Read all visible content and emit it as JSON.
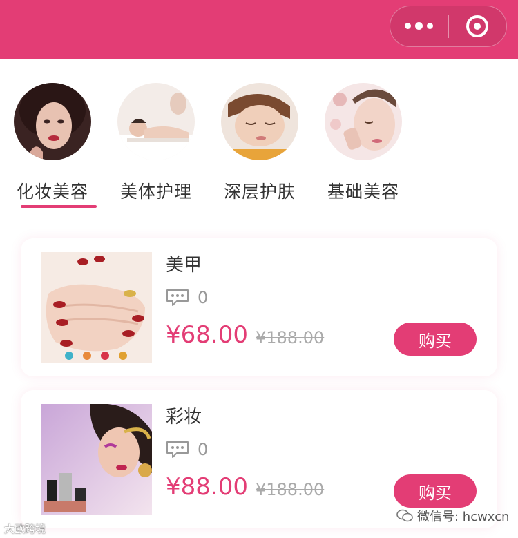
{
  "header": {
    "bg_color": "#e33d75",
    "more_icon": "more-dots-icon",
    "close_icon": "target-close-icon"
  },
  "categories": [
    {
      "label": "化妆美容",
      "active": true
    },
    {
      "label": "美体护理",
      "active": false
    },
    {
      "label": "深层护肤",
      "active": false
    },
    {
      "label": "基础美容",
      "active": false
    }
  ],
  "products": [
    {
      "name": "美甲",
      "comment_icon": "comment-icon",
      "comments": "0",
      "price": "¥68.00",
      "original_price": "¥188.00",
      "buy_label": "购买"
    },
    {
      "name": "彩妆",
      "comment_icon": "comment-icon",
      "comments": "0",
      "price": "¥88.00",
      "original_price": "¥188.00",
      "buy_label": "购买"
    }
  ],
  "watermark": {
    "left": "大欧跨境",
    "right": "微信号: hcwxcn"
  },
  "accent_color": "#e33d75"
}
